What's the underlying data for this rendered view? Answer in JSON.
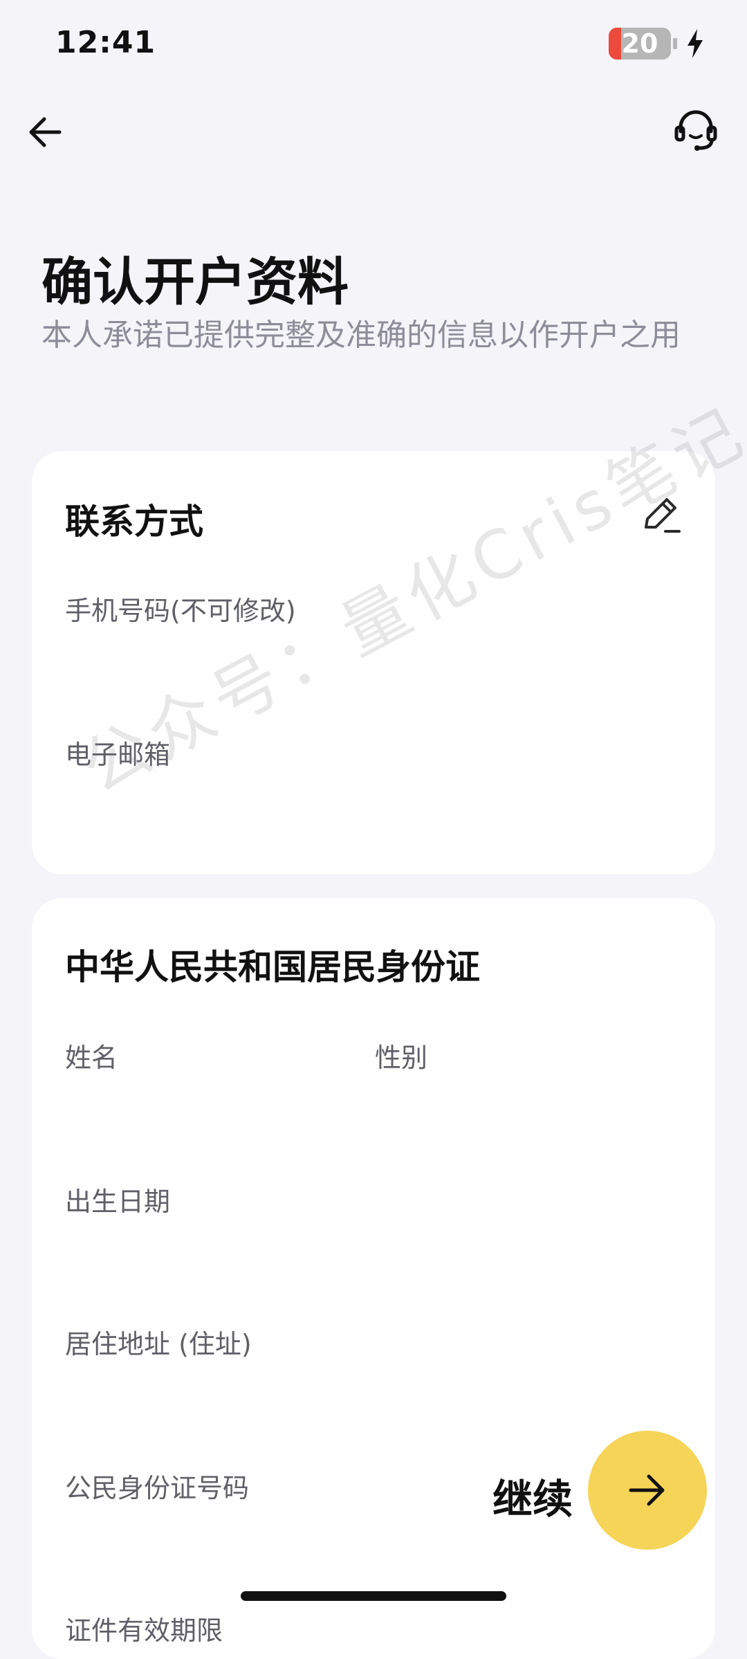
{
  "status_bar": {
    "time": "12:41",
    "battery_level": "20",
    "battery_color": "#eb4a3c",
    "charging_icon": "lightning-bolt-icon"
  },
  "nav": {
    "back_icon": "arrow-left-icon",
    "support_icon": "headset-icon"
  },
  "header": {
    "title": "确认开户资料",
    "subtitle": "本人承诺已提供完整及准确的信息以作开户之用"
  },
  "contact_card": {
    "title": "联系方式",
    "edit_icon": "pencil-icon",
    "phone_label": "手机号码(不可修改)",
    "email_label": "电子邮箱"
  },
  "id_card": {
    "title": "中华人民共和国居民身份证",
    "name_label": "姓名",
    "gender_label": "性别",
    "birthdate_label": "出生日期",
    "address_label": "居住地址 (住址)",
    "id_number_label": "公民身份证号码",
    "validity_label": "证件有效期限"
  },
  "footer": {
    "continue_label": "继续",
    "continue_icon": "arrow-right-icon",
    "accent_color": "#f6d457"
  },
  "watermark": "公众号：量化Cris笔记"
}
